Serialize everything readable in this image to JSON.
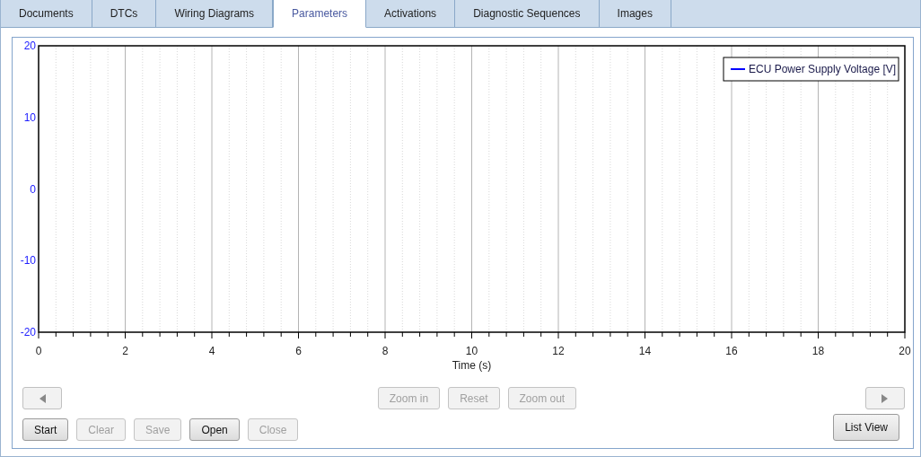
{
  "tabs": [
    {
      "label": "Documents",
      "selected": false
    },
    {
      "label": "DTCs",
      "selected": false
    },
    {
      "label": "Wiring Diagrams",
      "selected": false
    },
    {
      "label": "Parameters",
      "selected": true
    },
    {
      "label": "Activations",
      "selected": false
    },
    {
      "label": "Diagnostic Sequences",
      "selected": false
    },
    {
      "label": "Images",
      "selected": false
    }
  ],
  "plot": {
    "y_axis_labels": [
      "20",
      "10",
      "0",
      "-10",
      "-20"
    ],
    "x_axis_labels": [
      "0",
      "2",
      "4",
      "6",
      "8",
      "10",
      "12",
      "14",
      "16",
      "18",
      "20"
    ],
    "x_axis_title": "Time (s)",
    "legend": [
      {
        "label": "ECU Power Supply Voltage [V]",
        "color": "#0000ff"
      }
    ]
  },
  "zoom_buttons": [
    {
      "label": "Zoom in",
      "disabled": true
    },
    {
      "label": "Reset",
      "disabled": true
    },
    {
      "label": "Zoom out",
      "disabled": true
    }
  ],
  "record_buttons": [
    {
      "label": "Start",
      "disabled": false
    },
    {
      "label": "Clear",
      "disabled": true
    },
    {
      "label": "Save",
      "disabled": true
    },
    {
      "label": "Open",
      "disabled": false
    },
    {
      "label": "Close",
      "disabled": true
    }
  ],
  "view_button": {
    "label": "List View",
    "disabled": false
  }
}
